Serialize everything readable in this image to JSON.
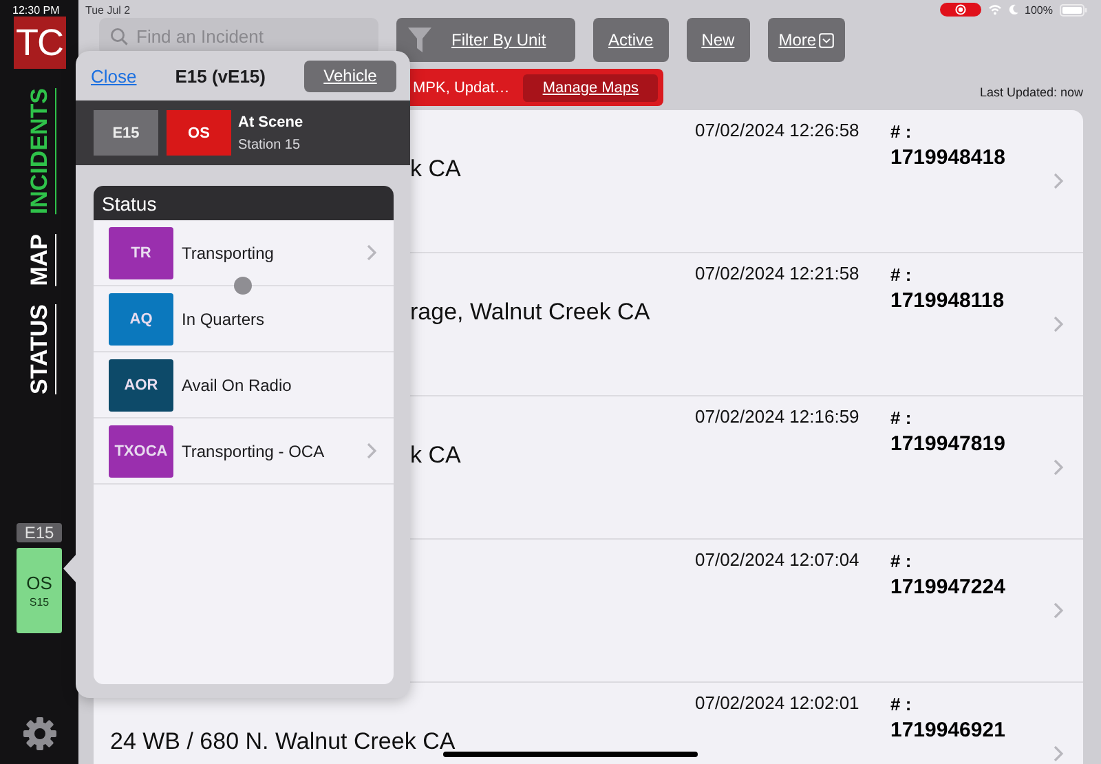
{
  "status_bar": {
    "time": "12:30 PM",
    "date": "Tue Jul 2",
    "battery": "100%",
    "recording": true
  },
  "sidebar": {
    "logo": "TC",
    "tabs": [
      {
        "label": "INCIDENTS",
        "selected": true
      },
      {
        "label": "MAP",
        "selected": false
      },
      {
        "label": "STATUS",
        "selected": false
      }
    ],
    "unit": {
      "name": "E15",
      "status": "OS",
      "station": "S15",
      "color": "#7fd88a"
    }
  },
  "toolbar": {
    "search": {
      "placeholder": "Find an Incident"
    },
    "buttons": [
      {
        "label": "Filter By Unit",
        "kind": "filter"
      },
      {
        "label": "Active",
        "kind": "plain"
      },
      {
        "label": "New",
        "kind": "plain"
      },
      {
        "label": "More",
        "kind": "dropdown"
      }
    ]
  },
  "banner": {
    "text": "MPK, Updat…",
    "button": "Manage Maps"
  },
  "last_updated": "Last Updated: now",
  "incidents": [
    {
      "address": "k CA",
      "kind": "partial",
      "time": "07/02/2024 12:26:58",
      "number_label": "# :",
      "number": "1719948418"
    },
    {
      "address": "rage, Walnut Creek CA",
      "kind": "partial",
      "time": "07/02/2024 12:21:58",
      "number_label": "# :",
      "number": "1719948118"
    },
    {
      "address": "k CA",
      "kind": "partial",
      "time": "07/02/2024 12:16:59",
      "number_label": "# :",
      "number": "1719947819"
    },
    {
      "time": "07/02/2024 12:07:04",
      "number_label": "# :",
      "number": "1719947224"
    },
    {
      "address": "24 WB / 680 N. Walnut Creek CA",
      "kind": "full",
      "time": "07/02/2024 12:02:01",
      "number_label": "# :",
      "number": "1719946921"
    }
  ],
  "popover": {
    "close": "Close",
    "title": "E15 (vE15)",
    "vehicle_button": "Vehicle",
    "unit_code": "E15",
    "status_code": "OS",
    "status_label": "At Scene",
    "station": "Station 15",
    "status_panel": {
      "title": "Status",
      "items": [
        {
          "code": "TR",
          "label": "Transporting",
          "color": "#9a2fae",
          "chevron": true
        },
        {
          "code": "AQ",
          "label": "In Quarters",
          "color": "#0b78bd",
          "chevron": false
        },
        {
          "code": "AOR",
          "label": "Avail On Radio",
          "color": "#0d4a69",
          "chevron": false
        },
        {
          "code": "TXOCA",
          "label": "Transporting - OCA",
          "color": "#9a2fae",
          "chevron": true
        }
      ]
    }
  }
}
